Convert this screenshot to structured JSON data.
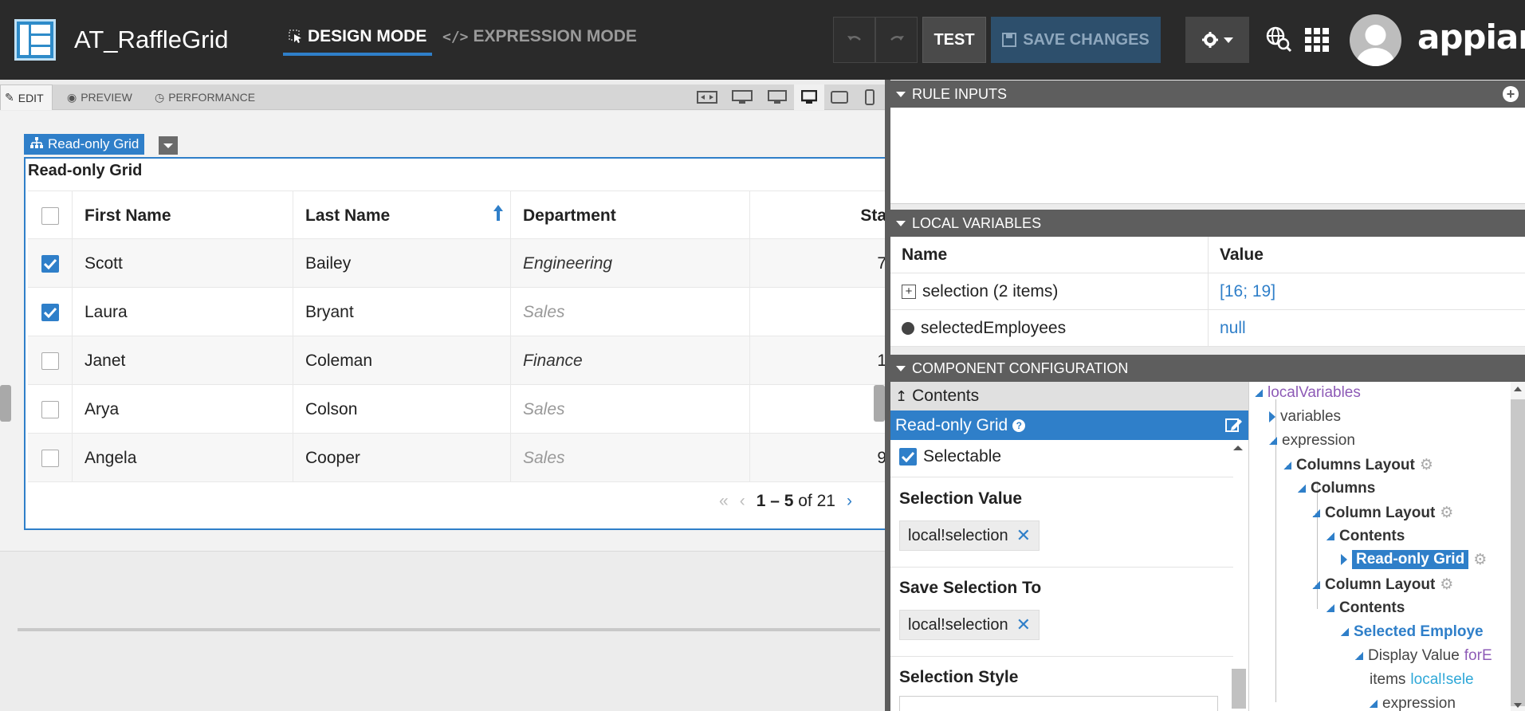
{
  "header": {
    "app_title": "AT_RaffleGrid",
    "design_mode_label": "DESIGN MODE",
    "expression_mode_label": "EXPRESSION MODE",
    "test_label": "TEST",
    "save_label": "SAVE CHANGES",
    "brand": "appian"
  },
  "subtabs": {
    "edit": "EDIT",
    "preview": "PREVIEW",
    "performance": "PERFORMANCE"
  },
  "canvas": {
    "component_tag": "Read-only Grid",
    "grid_label": "Read-only Grid",
    "columns": [
      "First Name",
      "Last Name",
      "Department",
      "Sta"
    ],
    "rows": [
      {
        "selected": true,
        "first": "Scott",
        "last": "Bailey",
        "department": "Engineering",
        "start": "7"
      },
      {
        "selected": true,
        "first": "Laura",
        "last": "Bryant",
        "department": "Sales",
        "start": ""
      },
      {
        "selected": false,
        "first": "Janet",
        "last": "Coleman",
        "department": "Finance",
        "start": "1"
      },
      {
        "selected": false,
        "first": "Arya",
        "last": "Colson",
        "department": "Sales",
        "start": ""
      },
      {
        "selected": false,
        "first": "Angela",
        "last": "Cooper",
        "department": "Sales",
        "start": "9"
      }
    ],
    "pager": {
      "range": "1 – 5",
      "of_text": "of 21"
    }
  },
  "rule_inputs": {
    "title": "RULE INPUTS"
  },
  "local_variables": {
    "title": "LOCAL VARIABLES",
    "col_name": "Name",
    "col_value": "Value",
    "rows": [
      {
        "name": "selection (2 items)",
        "value": "[16; 19]"
      },
      {
        "name": "selectedEmployees",
        "value": "null"
      }
    ]
  },
  "config": {
    "title": "COMPONENT CONFIGURATION",
    "contents_label": "Contents",
    "component_name": "Read-only Grid",
    "selectable_label": "Selectable",
    "selection_value_label": "Selection Value",
    "selection_value_token": "local!selection",
    "save_selection_label": "Save Selection To",
    "save_selection_token": "local!selection",
    "selection_style_label": "Selection Style"
  },
  "tree": {
    "nodes": [
      {
        "label": "localVariables"
      },
      {
        "label": "variables"
      },
      {
        "label": "expression"
      },
      {
        "label": "Columns Layout"
      },
      {
        "label": "Columns"
      },
      {
        "label": "Column Layout"
      },
      {
        "label": "Contents"
      },
      {
        "label": "Read-only Grid"
      },
      {
        "label": "Column Layout"
      },
      {
        "label": "Contents"
      },
      {
        "label": "Selected Employe"
      },
      {
        "label": "Display Value",
        "suffix": "forE"
      },
      {
        "label": "items",
        "suffix": "local!sele"
      },
      {
        "label": "expression"
      }
    ]
  },
  "colors": {
    "accent": "#2f7fc9",
    "topbar": "#2a2a2a",
    "section_header": "#5e5e5e"
  }
}
